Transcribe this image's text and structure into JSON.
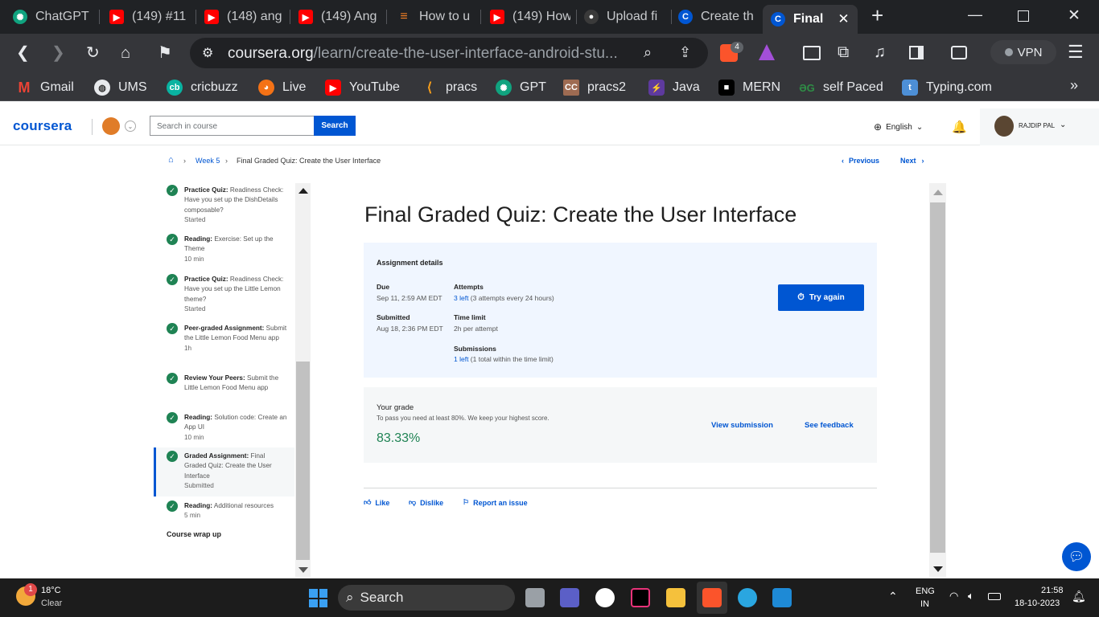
{
  "browser": {
    "tabs": [
      {
        "label": "ChatGPT",
        "icon": "chatgpt-icon"
      },
      {
        "label": "(149) #11",
        "icon": "youtube-icon"
      },
      {
        "label": "(148) ang",
        "icon": "youtube-icon"
      },
      {
        "label": "(149) Ang",
        "icon": "youtube-icon"
      },
      {
        "label": "How to u",
        "icon": "stackoverflow-icon"
      },
      {
        "label": "(149) How",
        "icon": "youtube-icon"
      },
      {
        "label": "Upload fi",
        "icon": "github-icon"
      },
      {
        "label": "Create th",
        "icon": "coursera-icon"
      },
      {
        "label": "Final",
        "icon": "coursera-icon"
      }
    ],
    "url_host": "coursera.org",
    "url_path": "/learn/create-the-user-interface-android-stu...",
    "brave_badge": "4",
    "vpn_label": "VPN",
    "bookmarks": [
      "Gmail",
      "UMS",
      "cricbuzz",
      "Live",
      "YouTube",
      "pracs",
      "GPT",
      "pracs2",
      "Java",
      "MERN",
      "self Paced",
      "Typing.com"
    ],
    "bookmark_more": "»"
  },
  "header": {
    "logo": "coursera",
    "search_placeholder": "Search in course",
    "search_button": "Search",
    "language": "English",
    "user_name": "RAJDIP PAL"
  },
  "breadcrumb": {
    "week": "Week 5",
    "current": "Final Graded Quiz: Create the User Interface",
    "previous": "Previous",
    "next": "Next"
  },
  "sidebar": {
    "items": [
      {
        "type": "Practice Quiz:",
        "title": "Readiness Check: Have you set up the DishDetails composable?",
        "meta": "Started"
      },
      {
        "type": "Reading:",
        "title": "Exercise: Set up the Theme",
        "meta": "10 min"
      },
      {
        "type": "Practice Quiz:",
        "title": "Readiness Check: Have you set up the Little Lemon theme?",
        "meta": "Started"
      },
      {
        "type": "Peer-graded Assignment:",
        "title": "Submit the Little Lemon Food Menu app",
        "meta": "1h"
      },
      {
        "type": "Review Your Peers:",
        "title": "Submit the Little Lemon Food Menu app",
        "meta": ""
      },
      {
        "type": "Reading:",
        "title": "Solution code: Create an App UI",
        "meta": "10 min"
      },
      {
        "type": "Graded Assignment:",
        "title": "Final Graded Quiz: Create the User Interface",
        "meta": "Submitted"
      },
      {
        "type": "Reading:",
        "title": "Additional resources",
        "meta": "5 min"
      }
    ],
    "section": "Course wrap up"
  },
  "main": {
    "title": "Final Graded Quiz: Create the User Interface",
    "assignment": {
      "heading": "Assignment details",
      "due_label": "Due",
      "due_value": "Sep 11, 2:59 AM EDT",
      "submitted_label": "Submitted",
      "submitted_value": "Aug 18, 2:36 PM EDT",
      "attempts_label": "Attempts",
      "attempts_left": "3 left",
      "attempts_rest": " (3 attempts every 24 hours)",
      "timelimit_label": "Time limit",
      "timelimit_value": "2h per attempt",
      "submissions_label": "Submissions",
      "submissions_left": "1 left",
      "submissions_rest": " (1 total within the time limit)",
      "try_again": "Try again"
    },
    "grade": {
      "label": "Your grade",
      "note": "To pass you need at least 80%. We keep your highest score.",
      "value": "83.33%",
      "view_submission": "View submission",
      "see_feedback": "See feedback"
    },
    "actions": {
      "like": "Like",
      "dislike": "Dislike",
      "report": "Report an issue"
    }
  },
  "taskbar": {
    "temp": "18°C",
    "weather": "Clear",
    "weather_badge": "1",
    "search": "Search",
    "lang1": "ENG",
    "lang2": "IN",
    "time": "21:58",
    "date": "18-10-2023"
  },
  "colors": {
    "brand": "#0056d2",
    "success": "#1f8354",
    "tab_bg": "#202225",
    "toolbar_bg": "#35363a"
  }
}
